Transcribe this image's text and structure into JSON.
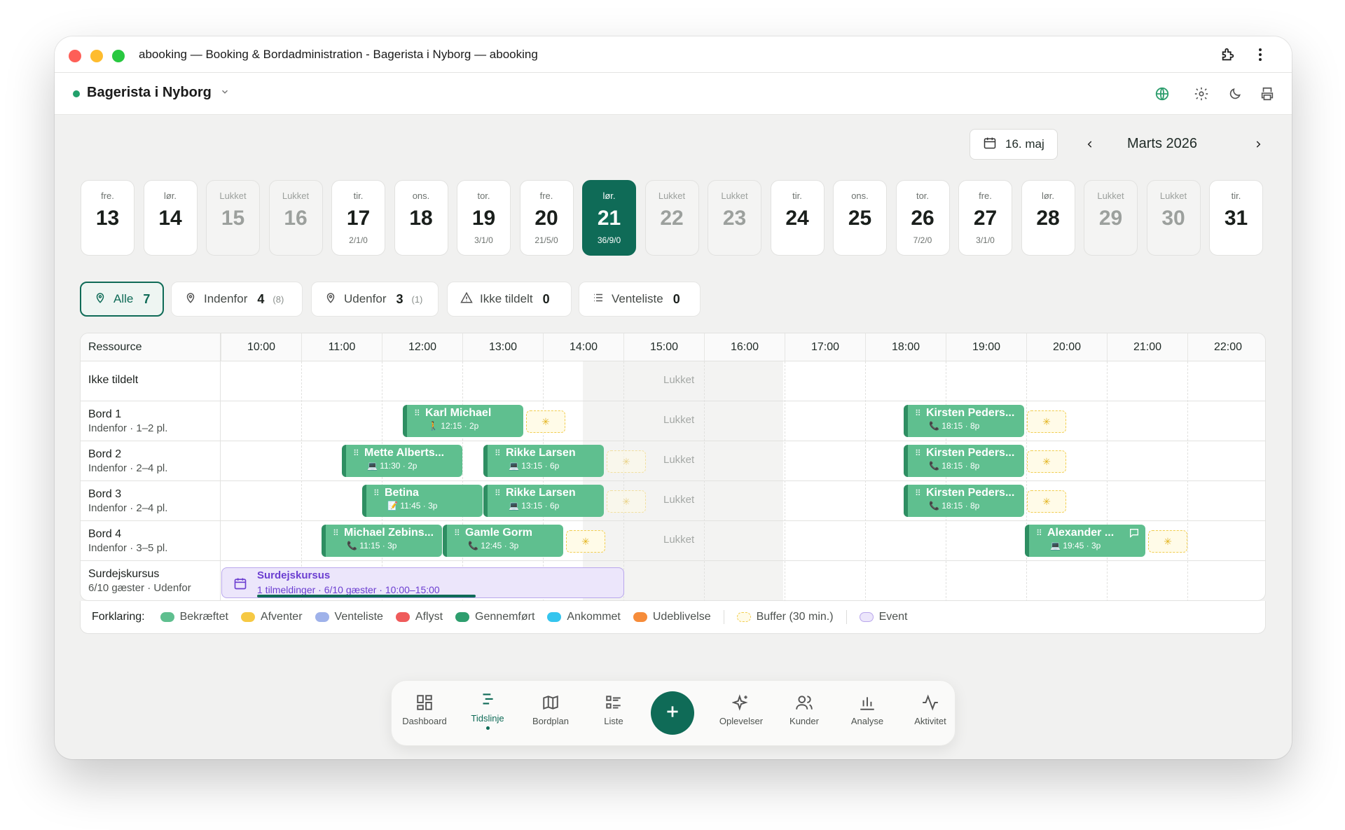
{
  "window": {
    "title": "abooking — Booking & Bordadministration - Bagerista i Nyborg — abooking"
  },
  "venue": {
    "name": "Bagerista i Nyborg"
  },
  "date_button": {
    "label": "16. maj"
  },
  "month": {
    "label": "Marts 2026"
  },
  "days": [
    {
      "name": "fre.",
      "num": "13",
      "sub": "",
      "state": "open"
    },
    {
      "name": "lør.",
      "num": "14",
      "sub": "",
      "state": "open"
    },
    {
      "name": "Lukket",
      "num": "15",
      "sub": "",
      "state": "closed"
    },
    {
      "name": "Lukket",
      "num": "16",
      "sub": "",
      "state": "closed"
    },
    {
      "name": "tir.",
      "num": "17",
      "sub": "2/1/0",
      "state": "open"
    },
    {
      "name": "ons.",
      "num": "18",
      "sub": "",
      "state": "open"
    },
    {
      "name": "tor.",
      "num": "19",
      "sub": "3/1/0",
      "state": "open"
    },
    {
      "name": "fre.",
      "num": "20",
      "sub": "21/5/0",
      "state": "open"
    },
    {
      "name": "lør.",
      "num": "21",
      "sub": "36/9/0",
      "state": "selected"
    },
    {
      "name": "Lukket",
      "num": "22",
      "sub": "",
      "state": "closed"
    },
    {
      "name": "Lukket",
      "num": "23",
      "sub": "",
      "state": "closed"
    },
    {
      "name": "tir.",
      "num": "24",
      "sub": "",
      "state": "open"
    },
    {
      "name": "ons.",
      "num": "25",
      "sub": "",
      "state": "open"
    },
    {
      "name": "tor.",
      "num": "26",
      "sub": "7/2/0",
      "state": "open"
    },
    {
      "name": "fre.",
      "num": "27",
      "sub": "3/1/0",
      "state": "open"
    },
    {
      "name": "lør.",
      "num": "28",
      "sub": "",
      "state": "open"
    },
    {
      "name": "Lukket",
      "num": "29",
      "sub": "",
      "state": "closed"
    },
    {
      "name": "Lukket",
      "num": "30",
      "sub": "",
      "state": "closed"
    },
    {
      "name": "tir.",
      "num": "31",
      "sub": "",
      "state": "open"
    }
  ],
  "filters": {
    "alle": {
      "label": "Alle",
      "count": "7"
    },
    "indenfor": {
      "label": "Indenfor",
      "count": "4",
      "sub": "(8)"
    },
    "udenfor": {
      "label": "Udenfor",
      "count": "3",
      "sub": "(1)"
    },
    "ikke_tildelt": {
      "label": "Ikke tildelt",
      "count": "0"
    },
    "venteliste": {
      "label": "Venteliste",
      "count": "0"
    }
  },
  "timeline": {
    "resource_header": "Ressource",
    "hours": [
      "10:00",
      "11:00",
      "12:00",
      "13:00",
      "14:00",
      "15:00",
      "16:00",
      "17:00",
      "18:00",
      "19:00",
      "20:00",
      "21:00",
      "22:00"
    ],
    "closed_label": "Lukket",
    "rows": [
      {
        "name": "Ikke tildelt",
        "sub": ""
      },
      {
        "name": "Bord 1",
        "sub": "Indenfor · 1–2 pl."
      },
      {
        "name": "Bord 2",
        "sub": "Indenfor · 2–4 pl."
      },
      {
        "name": "Bord 3",
        "sub": "Indenfor · 2–4 pl."
      },
      {
        "name": "Bord 4",
        "sub": "Indenfor · 3–5 pl."
      },
      {
        "name": "Surdejskursus",
        "sub": "6/10 gæster · Udenfor"
      }
    ],
    "bookings": {
      "b1a": {
        "name": "Karl Michael",
        "meta": "12:15 · 2p"
      },
      "b1b": {
        "name": "Kirsten Peders...",
        "meta": "18:15 · 8p"
      },
      "b2a": {
        "name": "Mette Alberts...",
        "meta": "11:30 · 2p"
      },
      "b2b": {
        "name": "Rikke Larsen",
        "meta": "13:15 · 6p"
      },
      "b2c": {
        "name": "Kirsten Peders...",
        "meta": "18:15 · 8p"
      },
      "b3a": {
        "name": "Betina",
        "meta": "11:45 · 3p"
      },
      "b3b": {
        "name": "Rikke Larsen",
        "meta": "13:15 · 6p"
      },
      "b3c": {
        "name": "Kirsten Peders...",
        "meta": "18:15 · 8p"
      },
      "b4a": {
        "name": "Michael Zebins...",
        "meta": "11:15 · 3p"
      },
      "b4b": {
        "name": "Gamle Gorm",
        "meta": "12:45 · 3p"
      },
      "b4c": {
        "name": "Alexander ...",
        "meta": "19:45 · 3p"
      }
    },
    "event": {
      "title": "Surdejskursus",
      "sub": "1 tilmeldinger · 6/10 gæster · 10:00–15:00",
      "progress": 0.6
    }
  },
  "legend": {
    "title": "Forklaring:",
    "items": [
      {
        "label": "Bekræftet",
        "color": "#5fbf8f"
      },
      {
        "label": "Afventer",
        "color": "#f6c944"
      },
      {
        "label": "Venteliste",
        "color": "#9fb2ea"
      },
      {
        "label": "Aflyst",
        "color": "#ef5b5b"
      },
      {
        "label": "Gennemført",
        "color": "#2e9e6e"
      },
      {
        "label": "Ankommet",
        "color": "#35c5ee"
      },
      {
        "label": "Udeblivelse",
        "color": "#f68c3a"
      }
    ],
    "buffer": "Buffer (30 min.)",
    "event": "Event"
  },
  "bottom_nav": {
    "dashboard": "Dashboard",
    "tidslinje": "Tidslinje",
    "bordplan": "Bordplan",
    "liste": "Liste",
    "oplevelser": "Oplevelser",
    "kunder": "Kunder",
    "analyse": "Analyse",
    "aktivitet": "Aktivitet"
  },
  "colors": {
    "accent": "#0f6b57",
    "booking_green": "#5fbf8f",
    "event_purple": "#6c3fd1"
  }
}
